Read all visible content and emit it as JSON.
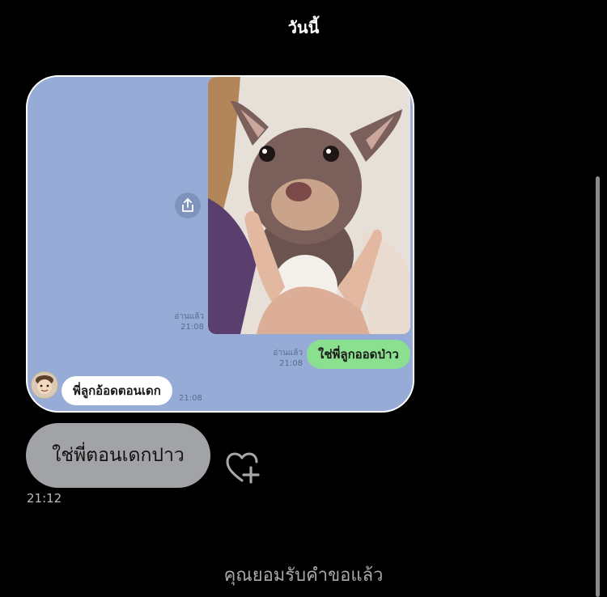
{
  "header": {
    "date_label": "วันนี้"
  },
  "quoted_screenshot": {
    "photo_alt": "dog-photo",
    "photo_read_status": "อ่านแล้ว",
    "photo_time": "21:08",
    "outgoing_message": "ใช่พี่ลูกออดป่าว",
    "outgoing_read_status": "อ่านแล้ว",
    "outgoing_time": "21:08",
    "incoming_message": "พี่ลูกอ้อดตอนเดก",
    "incoming_time": "21:08"
  },
  "message": {
    "text": "ใช่พี่ตอนเดกปาว",
    "time": "21:12"
  },
  "footer": {
    "status_note": "คุณยอมรับคำขอแล้ว"
  },
  "colors": {
    "background": "#000000",
    "card": "#96acd6",
    "green_bubble": "#8be08f",
    "gray_bubble": "#a1a3a6"
  }
}
